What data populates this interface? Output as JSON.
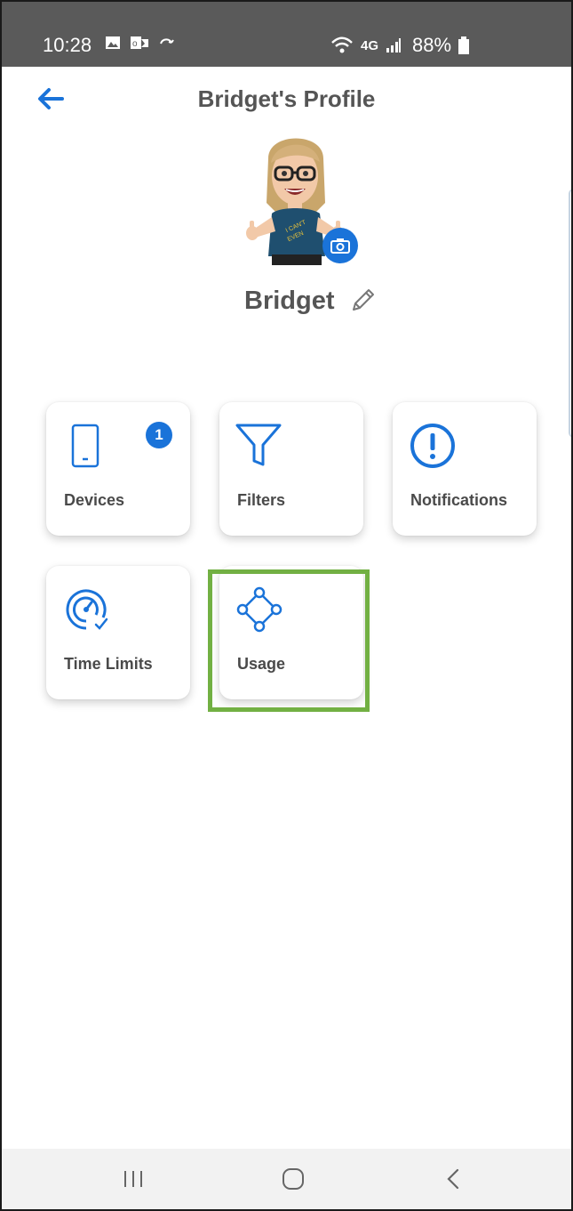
{
  "status_bar": {
    "time": "10:28",
    "network": "4G",
    "battery": "88%"
  },
  "header": {
    "title": "Bridget's Profile",
    "back_icon": "arrow-left-icon"
  },
  "profile": {
    "name": "Bridget",
    "avatar_shirt_text": "I CAN'T EVEN",
    "camera_icon": "camera-icon",
    "edit_icon": "pencil-icon"
  },
  "tiles": [
    {
      "label": "Devices",
      "icon": "phone-icon",
      "badge": "1"
    },
    {
      "label": "Filters",
      "icon": "filter-icon"
    },
    {
      "label": "Notifications",
      "icon": "alert-circle-icon"
    },
    {
      "label": "Time Limits",
      "icon": "speedometer-icon"
    },
    {
      "label": "Usage",
      "icon": "usage-icon",
      "highlighted": true
    }
  ],
  "nav": {
    "recents_icon": "recents-icon",
    "home_icon": "home-icon",
    "back_icon": "back-chevron-icon"
  },
  "colors": {
    "accent": "#1a73d9",
    "highlight": "#72b043",
    "status_bar": "#5a5a5a",
    "title_text": "#555555"
  }
}
